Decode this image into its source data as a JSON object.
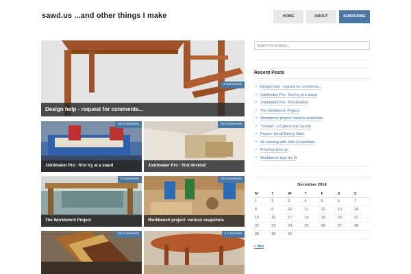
{
  "site": {
    "title": "sawd.us ...and other things I make"
  },
  "nav": {
    "home": "HOME",
    "about": "ABOUT",
    "subscribe": "SUBSCRIBE"
  },
  "featured": {
    "title": "Design help - request for comments...",
    "comments": "6 Comments"
  },
  "posts": [
    {
      "title": "Jointmaker Pro - first try at a stand",
      "comments": "No Comments"
    },
    {
      "title": "Jointmaker Pro - first dovetail",
      "comments": "No Comments"
    },
    {
      "title": "The Workbench Project",
      "comments": "4 Comments"
    },
    {
      "title": "Workbench project: various snapshots",
      "comments": "No Comments"
    },
    {
      "title": "",
      "comments": "No Comments"
    },
    {
      "title": "",
      "comments": "1 Comment"
    }
  ],
  "sidebar": {
    "search_placeholder": "Search the archives...",
    "recent_heading": "Recent Posts",
    "recent_posts": [
      "Design help - request for comments...",
      "Jointmaker Pro - first try at a stand",
      "Jointmaker Pro - first dovetail",
      "The Workbench Project",
      "Workbench project: various snapshots",
      "\"Torture\", a 6-piece burr puzzle",
      "Project: Small Dining Table",
      "An evening with John Economaki",
      "Final top glue-up",
      "Workbench legs dry fit"
    ],
    "calendar": {
      "title": "December 2014",
      "days": [
        "M",
        "T",
        "W",
        "T",
        "F",
        "S",
        "S"
      ],
      "weeks": [
        [
          "1",
          "2",
          "3",
          "4",
          "5",
          "6",
          "7"
        ],
        [
          "8",
          "9",
          "10",
          "11",
          "12",
          "13",
          "14"
        ],
        [
          "15",
          "16",
          "17",
          "18",
          "19",
          "20",
          "21"
        ],
        [
          "22",
          "23",
          "24",
          "25",
          "26",
          "27",
          "28"
        ],
        [
          "29",
          "30",
          "31",
          "",
          "",
          "",
          ""
        ]
      ],
      "prev": "« Mar"
    }
  },
  "colors": {
    "accent": "#4a77a3",
    "link": "#3a6fa0",
    "caption_bg": "#282828"
  }
}
